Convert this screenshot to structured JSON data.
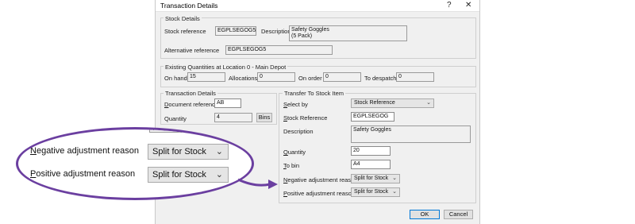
{
  "window": {
    "title": "Transaction Details",
    "help_glyph": "?",
    "close_glyph": "✕"
  },
  "stock_details": {
    "group_label": "Stock Details",
    "stock_reference_label": "Stock reference",
    "stock_reference_value": "EGPLSEGOG5",
    "description_label": "Description",
    "description_line1": "Safety Goggles",
    "description_line2": "(5 Pack)",
    "alt_reference_label": "Alternative reference",
    "alt_reference_value": "EGPLSEGOG5"
  },
  "existing_quantities": {
    "group_label": "Existing Quantities at Location 0 - Main Depot",
    "on_hand_label": "On hand",
    "on_hand_value": "15",
    "allocations_label": "Allocations",
    "allocations_value": "0",
    "on_order_label": "On order",
    "on_order_value": "0",
    "to_despatch_label": "To despatch",
    "to_despatch_value": "0"
  },
  "transaction_details": {
    "group_label": "Transaction Details",
    "doc_ref_label_u": "D",
    "doc_ref_label_rest": "ocument reference",
    "doc_ref_value": "AB",
    "quantity_label": "Quantity",
    "quantity_value": "4",
    "bins_button": "Bins"
  },
  "transfer": {
    "group_label": "Transfer To Stock Item",
    "select_by_label_u": "S",
    "select_by_label_rest": "elect by",
    "select_by_value": "Stock Reference",
    "stock_ref_label_u": "S",
    "stock_ref_label_rest": "tock Reference",
    "stock_ref_value": "EGPLSEGOG",
    "description_label": "Description",
    "description_value": "Safety Goggles",
    "quantity_label_u": "Q",
    "quantity_label_rest": "uantity",
    "quantity_value": "20",
    "to_bin_label_u": "T",
    "to_bin_label_rest": "o bin",
    "to_bin_value": "A4",
    "neg_label_u": "N",
    "neg_label_rest": "egative adjustment reason",
    "neg_value": "Split for Stock",
    "pos_label_u": "P",
    "pos_label_rest": "ositive adjustment reason",
    "pos_value": "Split for Stock"
  },
  "footer": {
    "ok_label": "OK",
    "cancel_label": "Cancel"
  },
  "callout": {
    "partial_value": "4",
    "neg_label_u": "N",
    "neg_label_rest": "egative adjustment reason",
    "neg_value": "Split for Stock",
    "pos_label_u": "P",
    "pos_label_rest": "ositive adjustment reason",
    "pos_value": "Split for Stock"
  },
  "icons": {
    "chevron": "chevron-down-icon",
    "accent_color": "#6b3fa0",
    "ok_border": "#0078d7"
  }
}
